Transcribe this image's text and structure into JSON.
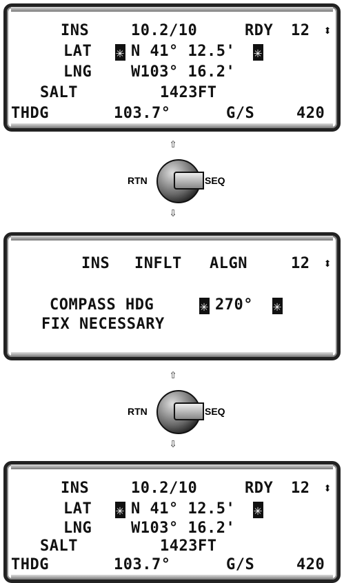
{
  "panel1": {
    "r1": {
      "label": "INS",
      "value": "10.2/10",
      "status": "RDY",
      "num": "12"
    },
    "r2": {
      "label": "LAT",
      "hl1": "✳",
      "value": "N 41° 12.5'",
      "hl2": "✳"
    },
    "r3": {
      "label": "LNG",
      "value": "W103° 16.2'"
    },
    "r4": {
      "label": "SALT",
      "value": "1423FT"
    },
    "r5": {
      "label": "THDG",
      "value": "103.7°",
      "gs": "G/S",
      "gsval": "420"
    },
    "updown": "⬍"
  },
  "knob1": {
    "rtn": "RTN",
    "seq": "SEQ",
    "up": "⇧",
    "down": "⇩"
  },
  "panel2": {
    "r1": {
      "a": "INS",
      "b": "INFLT",
      "c": "ALGN",
      "num": "12"
    },
    "r2": {
      "label": "COMPASS HDG",
      "hl1": "✳",
      "value": "270°",
      "hl2": "✳"
    },
    "r3": {
      "text": "FIX NECESSARY"
    },
    "updown": "⬍"
  },
  "knob2": {
    "rtn": "RTN",
    "seq": "SEQ",
    "up": "⇧",
    "down": "⇩"
  },
  "panel3": {
    "r1": {
      "label": "INS",
      "value": "10.2/10",
      "status": "RDY",
      "num": "12"
    },
    "r2": {
      "label": "LAT",
      "hl1": "✳",
      "value": "N 41° 12.5'",
      "hl2": "✳"
    },
    "r3": {
      "label": "LNG",
      "value": "W103° 16.2'"
    },
    "r4": {
      "label": "SALT",
      "value": "1423FT"
    },
    "r5": {
      "label": "THDG",
      "value": "103.7°",
      "gs": "G/S",
      "gsval": "420"
    },
    "updown": "⬍"
  }
}
